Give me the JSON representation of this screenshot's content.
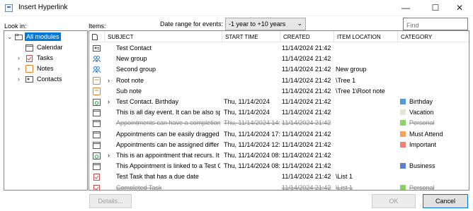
{
  "window": {
    "title": "Insert Hyperlink",
    "minimize": "—",
    "maximize": "☐",
    "close": "✕"
  },
  "look_in_label": "Look in:",
  "items_label": "Items:",
  "date_range": {
    "label": "Date range for events:",
    "value": "-1 year to +10 years",
    "chevron": "⌄"
  },
  "find": {
    "placeholder": "Find"
  },
  "tree": [
    {
      "label": "All modules",
      "expander": "⌄",
      "icon": "folder-icon",
      "selected": true
    },
    {
      "label": "Calendar",
      "expander": "",
      "icon": "calendar-icon"
    },
    {
      "label": "Tasks",
      "expander": "›",
      "icon": "task-icon"
    },
    {
      "label": "Notes",
      "expander": "›",
      "icon": "note-icon"
    },
    {
      "label": "Contacts",
      "expander": "›",
      "icon": "contact-icon"
    }
  ],
  "columns": [
    "SUBJECT",
    "START TIME",
    "CREATED",
    "ITEM LOCATION",
    "CATEGORY"
  ],
  "rows": [
    {
      "icon": "contact-card-icon",
      "expander": "",
      "subject": "Test Contact",
      "start": "",
      "created": "11/14/2024 21:42",
      "location": "",
      "category": "",
      "cat_color": "",
      "done": false
    },
    {
      "icon": "group-icon",
      "expander": "",
      "subject": "New group",
      "start": "",
      "created": "11/14/2024 21:42",
      "location": "",
      "category": "",
      "cat_color": "",
      "done": false
    },
    {
      "icon": "group-icon",
      "expander": "",
      "subject": "Second group",
      "start": "",
      "created": "11/14/2024 21:42",
      "location": "New group",
      "category": "",
      "cat_color": "",
      "done": false
    },
    {
      "icon": "note-icon",
      "expander": "›",
      "subject": "Root note",
      "start": "",
      "created": "11/14/2024 21:42",
      "location": "\\Tree 1",
      "category": "",
      "cat_color": "",
      "done": false
    },
    {
      "icon": "note-icon",
      "expander": "",
      "subject": "Sub note",
      "start": "",
      "created": "11/14/2024 21:42",
      "location": "\\Tree 1\\Root note",
      "category": "",
      "cat_color": "",
      "done": false
    },
    {
      "icon": "recurring-calendar-icon",
      "expander": "›",
      "subject": "Test Contact. Birthday",
      "start": "Thu, 11/14/2024",
      "created": "11/14/2024 21:42",
      "location": "",
      "category": "Birthday",
      "cat_color": "#4f9ad8",
      "done": false
    },
    {
      "icon": "calendar-icon",
      "expander": "",
      "subject": "This is all day event. It can be also spre",
      "start": "Thu, 11/14/2024",
      "created": "11/14/2024 21:42",
      "location": "",
      "category": "Vacation",
      "cat_color": "#e6e6d2",
      "done": false
    },
    {
      "icon": "calendar-icon",
      "expander": "",
      "subject": "Appointments can have a completion",
      "start": "Thu, 11/14/2024 14:2",
      "created": "11/14/2024 21:42",
      "location": "",
      "category": "Personal",
      "cat_color": "#8fcf6c",
      "done": true
    },
    {
      "icon": "calendar-icon",
      "expander": "",
      "subject": "Appointments can be easily dragged",
      "start": "Thu, 11/14/2024 17:0",
      "created": "11/14/2024 21:42",
      "location": "",
      "category": "Must Attend",
      "cat_color": "#f4a45c",
      "done": false
    },
    {
      "icon": "calendar-icon",
      "expander": "",
      "subject": "Appointments can be assigned differ",
      "start": "Thu, 11/14/2024 12:3",
      "created": "11/14/2024 21:42",
      "location": "",
      "category": "Important",
      "cat_color": "#f08070",
      "done": false
    },
    {
      "icon": "recurring-calendar-icon",
      "expander": "›",
      "subject": "This is an appointment that recurs. It i",
      "start": "Thu, 11/14/2024 08:3",
      "created": "11/14/2024 21:42",
      "location": "",
      "category": "",
      "cat_color": "",
      "done": false
    },
    {
      "icon": "calendar-icon",
      "expander": "",
      "subject": "This Appointment is linked to a Test C",
      "start": "Thu, 11/14/2024 08:3",
      "created": "11/14/2024 21:42",
      "location": "",
      "category": "Business",
      "cat_color": "#5b7fd2",
      "done": false
    },
    {
      "icon": "task-icon",
      "expander": "",
      "subject": "Test Task that has a due date",
      "start": "",
      "created": "11/14/2024 21:42",
      "location": "\\List 1",
      "category": "",
      "cat_color": "",
      "done": false
    },
    {
      "icon": "task-icon",
      "expander": "",
      "subject": "Completed Task",
      "start": "",
      "created": "11/14/2024 21:42",
      "location": "\\List 1",
      "category": "Personal",
      "cat_color": "#8fcf6c",
      "done": true
    }
  ],
  "buttons": {
    "details": "Details...",
    "ok": "OK",
    "cancel": "Cancel"
  }
}
